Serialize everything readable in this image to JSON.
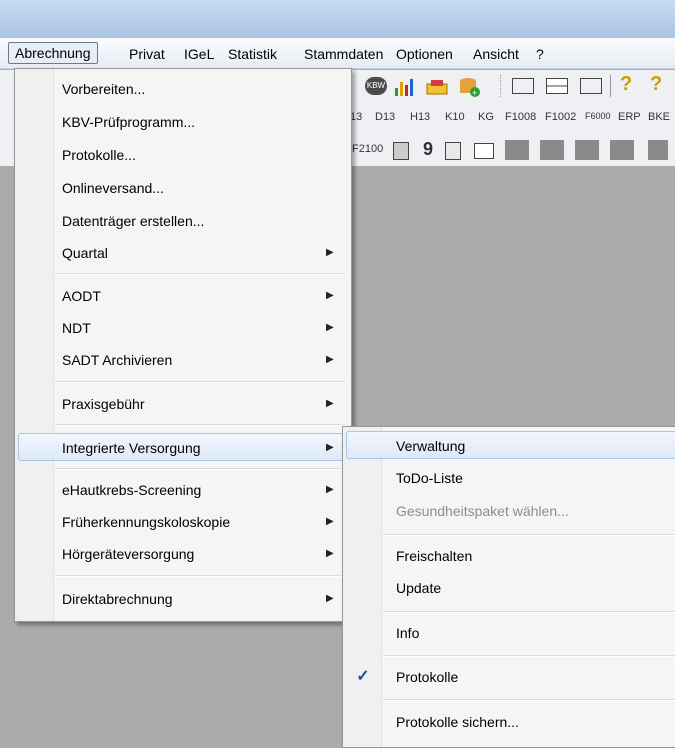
{
  "menubar": {
    "items": [
      "Abrechnung",
      "Privat",
      "IGeL",
      "Statistik",
      "Stammdaten",
      "Optionen",
      "Ansicht",
      "?"
    ]
  },
  "toolbar": {
    "kbv_badge": "KBW",
    "codes_row2": [
      "13",
      "D13",
      "H13",
      "K10",
      "KG",
      "F1008",
      "F1002",
      "F6000",
      "ERP",
      "BKE"
    ],
    "codes_row3": [
      "F2100",
      "9"
    ]
  },
  "menu": {
    "items": [
      {
        "label": "Vorbereiten...",
        "submenu": false
      },
      {
        "label": "KBV-Prüfprogramm...",
        "submenu": false
      },
      {
        "label": "Protokolle...",
        "submenu": false
      },
      {
        "label": "Onlineversand...",
        "submenu": false
      },
      {
        "label": "Datenträger erstellen...",
        "submenu": false
      },
      {
        "label": "Quartal",
        "submenu": true
      },
      {
        "label": "AODT",
        "submenu": true
      },
      {
        "label": "NDT",
        "submenu": true
      },
      {
        "label": "SADT Archivieren",
        "submenu": true
      },
      {
        "label": "Praxisgebühr",
        "submenu": true
      },
      {
        "label": "Integrierte Versorgung",
        "submenu": true
      },
      {
        "label": "eHautkrebs-Screening",
        "submenu": true
      },
      {
        "label": "Früherkennungskoloskopie",
        "submenu": true
      },
      {
        "label": "Hörgeräteversorgung",
        "submenu": true
      },
      {
        "label": "Direktabrechnung",
        "submenu": true
      }
    ],
    "arrow": "▶"
  },
  "submenu": {
    "items": [
      {
        "label": "Verwaltung",
        "enabled": true,
        "checked": false
      },
      {
        "label": "ToDo-Liste",
        "enabled": true,
        "checked": false
      },
      {
        "label": "Gesundheitspaket wählen...",
        "enabled": false,
        "checked": false
      },
      {
        "label": "Freischalten",
        "enabled": true,
        "checked": false
      },
      {
        "label": "Update",
        "enabled": true,
        "checked": false
      },
      {
        "label": "Info",
        "enabled": true,
        "checked": false
      },
      {
        "label": "Protokolle",
        "enabled": true,
        "checked": true
      },
      {
        "label": "Protokolle sichern...",
        "enabled": true,
        "checked": false
      }
    ],
    "check_glyph": "✓"
  },
  "colors": {
    "highlight_border": "#a8c4e9",
    "workspace": "#ababab"
  }
}
